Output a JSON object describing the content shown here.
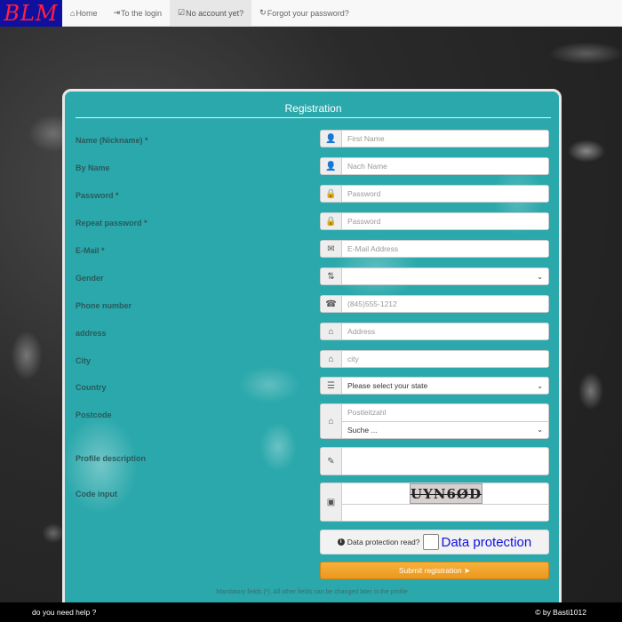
{
  "brand": {
    "logo_text": "BLM",
    "colors": {
      "bg": "#1010a0",
      "text": "#ff2040"
    }
  },
  "nav": {
    "items": [
      {
        "icon": "home-icon",
        "label": "Home"
      },
      {
        "icon": "login-icon",
        "label": "To the login"
      },
      {
        "icon": "check-square-icon",
        "label": "No account yet?"
      },
      {
        "icon": "forgot-password-icon",
        "label": "Forgot your password?"
      }
    ],
    "active_index": 2
  },
  "form": {
    "title": "Registration",
    "labels": {
      "nickname": "Name (Nickname) *",
      "byname": "By Name",
      "password": "Password *",
      "repeat_password": "Repeat password *",
      "email": "E-Mail *",
      "gender": "Gender",
      "phone": "Phone number",
      "address": "address",
      "city": "City",
      "country": "Country",
      "postcode": "Postcode",
      "profile": "Profile description",
      "code": "Code input"
    },
    "placeholders": {
      "nickname": "First Name",
      "byname": "Nach Name",
      "password": "Password",
      "repeat_password": "Password",
      "email": "E-Mail Address",
      "phone": "(845)555-1212",
      "address": "Address",
      "city": "city",
      "postcode": "Postleitzahl"
    },
    "selects": {
      "gender": "",
      "country": "Please select your state",
      "postcode_search": "Suche ..."
    },
    "captcha_text": "UYN6ØD",
    "data_protection": {
      "label": "Data protection read?",
      "link": "Data protection"
    },
    "submit_label": "Submit registration",
    "footnote": "Mandatory fields (*). All other fields can be changed later in the profile"
  },
  "footer": {
    "help": "do you need help ?",
    "copyright": "© by Basti1012"
  },
  "colors": {
    "panel": "#2aa8ab",
    "submit": "#f0a030",
    "link": "#1010e0"
  }
}
